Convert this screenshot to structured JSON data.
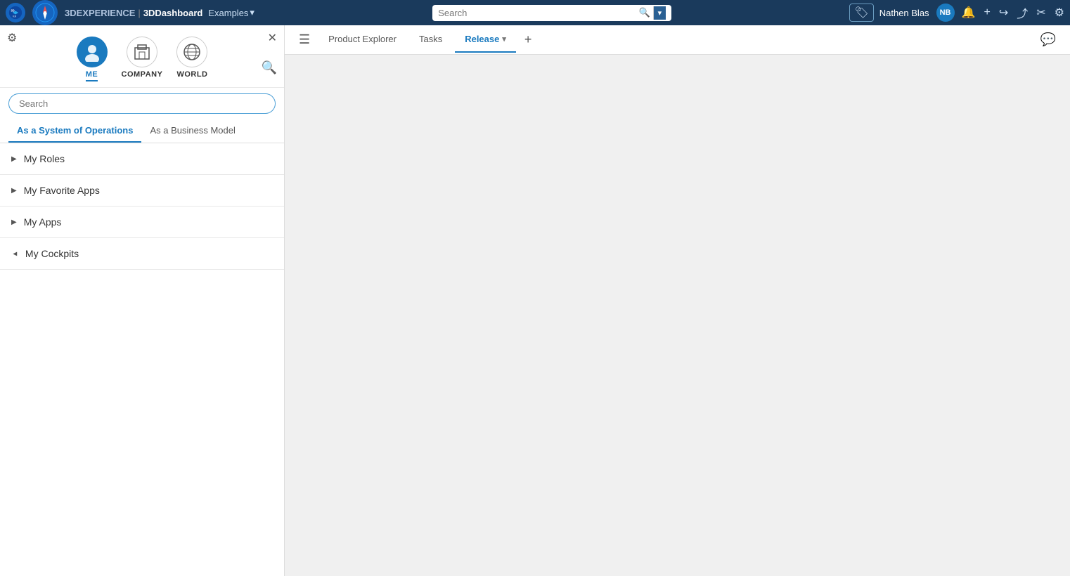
{
  "topbar": {
    "brand": "3DEXPERIENCE",
    "separator": "|",
    "app": "3DDashboard",
    "examples_label": "Examples",
    "search_placeholder": "Search",
    "username": "Nathen Blas",
    "avatar_initials": "NB"
  },
  "panel": {
    "me_label": "ME",
    "company_label": "COMPANY",
    "world_label": "WORLD",
    "search_placeholder": "Search",
    "tab_system": "As a System of Operations",
    "tab_business": "As a Business Model",
    "items": [
      {
        "label": "My Roles",
        "expanded": false
      },
      {
        "label": "My Favorite Apps",
        "expanded": false
      },
      {
        "label": "My Apps",
        "expanded": false
      },
      {
        "label": "My Cockpits",
        "expanded": true
      }
    ]
  },
  "content": {
    "menu_icon": "☰",
    "tab_product_explorer": "Product Explorer",
    "tab_tasks": "Tasks",
    "tab_release": "Release",
    "tab_add": "+"
  }
}
